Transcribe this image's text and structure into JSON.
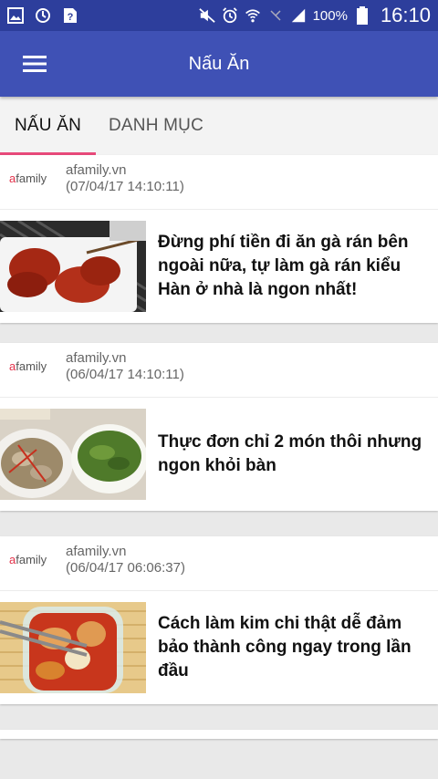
{
  "status_bar": {
    "battery": "100%",
    "time": "16:10",
    "icons": [
      "gallery-icon",
      "sync-icon",
      "help-icon",
      "mute-icon",
      "alarm-icon",
      "wifi-icon",
      "no-signal-icon",
      "signal-icon",
      "battery-icon"
    ]
  },
  "app_bar": {
    "title": "Nấu Ăn",
    "menu_icon": "hamburger-menu-icon"
  },
  "tabs": [
    {
      "label": "NẤU ĂN",
      "active": true
    },
    {
      "label": "DANH MỤC",
      "active": false
    }
  ],
  "articles": [
    {
      "logo": "afamily",
      "source": "afamily.vn",
      "time": "(07/04/17 14:10:11)",
      "headline": "Đừng phí tiền đi ăn gà rán bên ngoài nữa, tự làm gà rán kiểu Hàn ở nhà là ngon nhất!",
      "thumb": "fried-chicken-image"
    },
    {
      "logo": "afamily",
      "source": "afamily.vn",
      "time": "(06/04/17 14:10:11)",
      "headline": "Thực đơn chỉ 2 món thôi nhưng ngon khỏi bàn",
      "thumb": "clams-and-soup-image"
    },
    {
      "logo": "afamily",
      "source": "afamily.vn",
      "time": "(06/04/17 06:06:37)",
      "headline": "Cách làm kim chi thật dễ đảm bảo thành công ngay trong lần đầu",
      "thumb": "kimchi-jar-image"
    }
  ],
  "colors": {
    "status_bar": "#2d3e9c",
    "app_bar": "#3f51b5",
    "tab_indicator": "#e84a7a",
    "logo_accent": "#e2314a"
  }
}
